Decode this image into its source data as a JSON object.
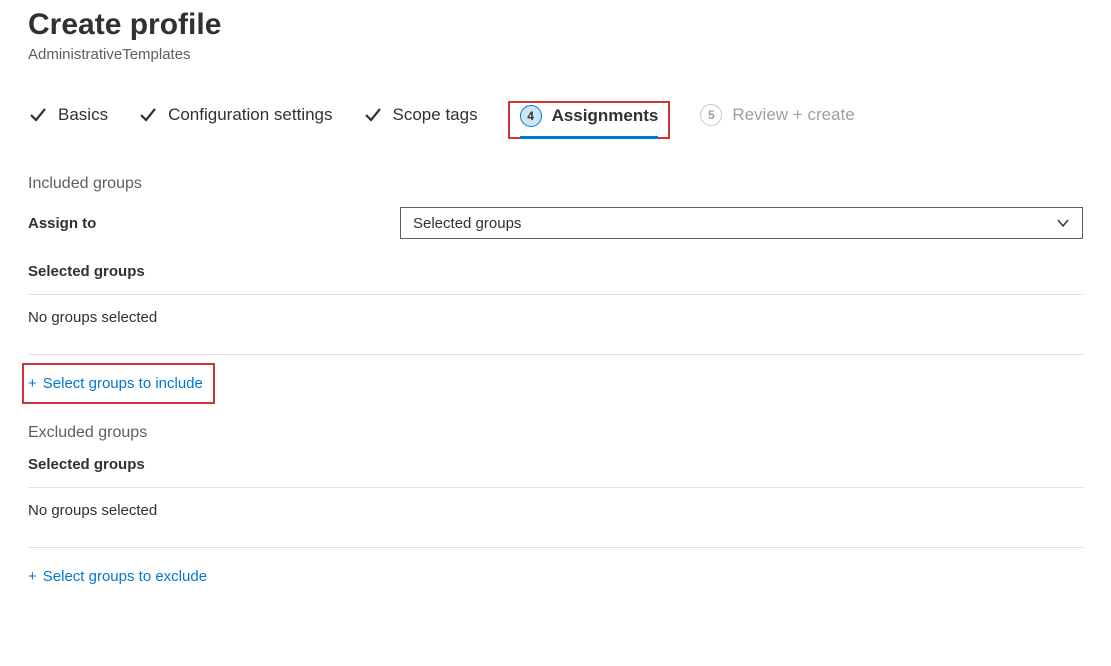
{
  "header": {
    "title": "Create profile",
    "subtitle": "AdministrativeTemplates"
  },
  "steps": {
    "basics": "Basics",
    "config": "Configuration settings",
    "scope": "Scope tags",
    "assignments_num": "4",
    "assignments": "Assignments",
    "review_num": "5",
    "review": "Review + create"
  },
  "included": {
    "heading": "Included groups",
    "assign_label": "Assign to",
    "assign_value": "Selected groups",
    "selected_heading": "Selected groups",
    "empty": "No groups selected",
    "action": "Select groups to include"
  },
  "excluded": {
    "heading": "Excluded groups",
    "selected_heading": "Selected groups",
    "empty": "No groups selected",
    "action": "Select groups to exclude"
  }
}
